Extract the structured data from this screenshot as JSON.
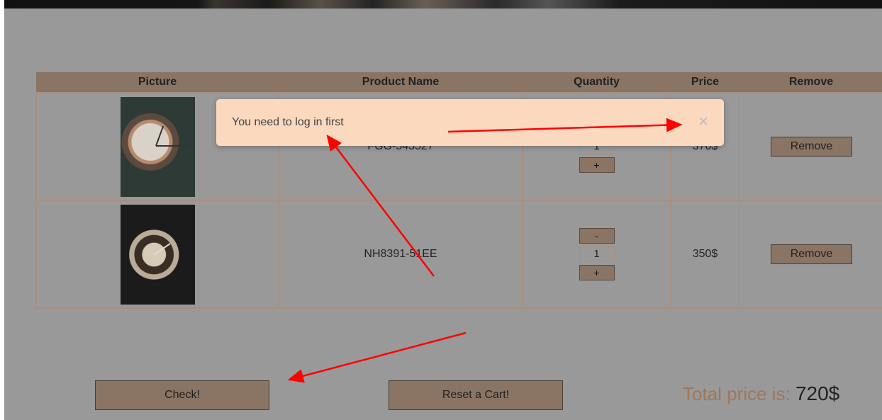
{
  "table": {
    "headers": [
      "Picture",
      "Product Name",
      "Quantity",
      "Price",
      "Remove"
    ],
    "rows": [
      {
        "product_name": "FGG-545527",
        "quantity": "1",
        "price": "370$",
        "minus_label": "-",
        "plus_label": "+",
        "remove_label": "Remove"
      },
      {
        "product_name": "NH8391-51EE",
        "quantity": "1",
        "price": "350$",
        "minus_label": "-",
        "plus_label": "+",
        "remove_label": "Remove"
      }
    ]
  },
  "actions": {
    "check_label": "Check!",
    "reset_label": "Reset a Cart!"
  },
  "total": {
    "label": "Total price is:",
    "value": "720$"
  },
  "toast": {
    "message": "You need to log in first",
    "close_glyph": "×"
  },
  "colors": {
    "accent": "#8a7463",
    "toast_bg": "#fad9bf",
    "overlay": "#999999",
    "annotation": "#ff0000"
  }
}
